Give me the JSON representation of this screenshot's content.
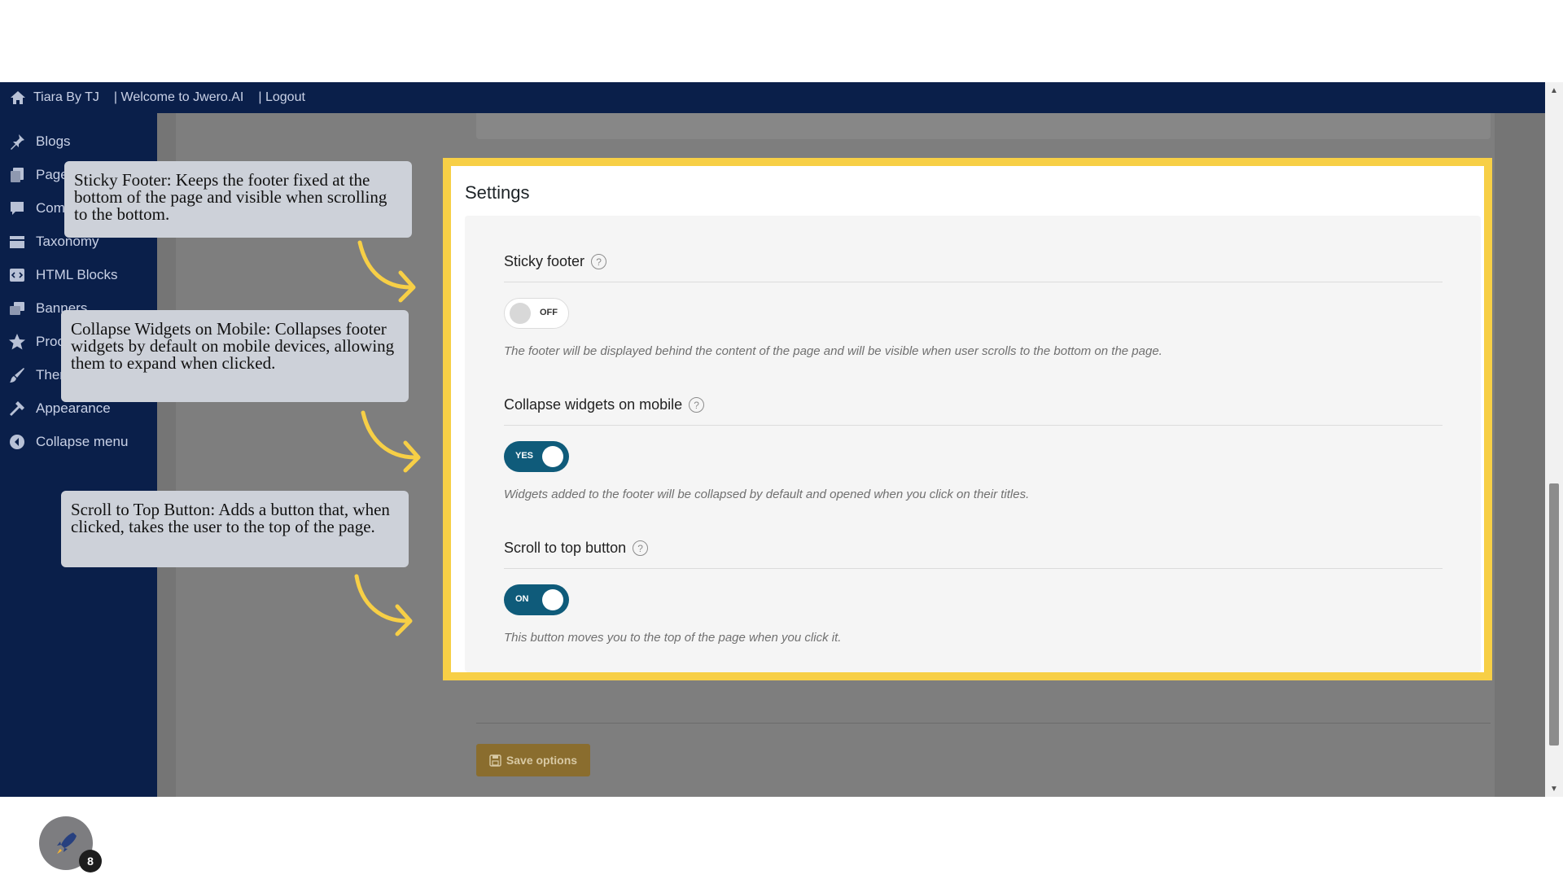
{
  "admin_bar": {
    "site_name": "Tiara By TJ",
    "welcome": "| Welcome to Jwero.AI",
    "logout": "| Logout"
  },
  "sidebar": {
    "items": [
      {
        "label": "Blogs",
        "icon": "pin-icon"
      },
      {
        "label": "Page",
        "icon": "pages-icon"
      },
      {
        "label": "Com",
        "icon": "comment-icon"
      },
      {
        "label": "Taxonomy",
        "icon": "taxonomy-icon"
      },
      {
        "label": "HTML Blocks",
        "icon": "code-block-icon"
      },
      {
        "label": "Banners",
        "icon": "banner-icon"
      },
      {
        "label": "Proc",
        "icon": "star-icon"
      },
      {
        "label": "Ther",
        "icon": "brush-icon"
      },
      {
        "label": "Appearance",
        "icon": "hammer-icon"
      },
      {
        "label": "Collapse menu",
        "icon": "collapse-icon"
      }
    ],
    "avatar_icon": "rocket-icon",
    "notification_count": "8"
  },
  "settings": {
    "title": "Settings",
    "sticky_footer": {
      "label": "Sticky footer",
      "toggle_state": "OFF",
      "description": "The footer will be displayed behind the content of the page and will be visible when user scrolls to the bottom on the page."
    },
    "collapse_widgets": {
      "label": "Collapse widgets on mobile",
      "toggle_state": "YES",
      "description": "Widgets added to the footer will be collapsed by default and opened when you click on their titles."
    },
    "scroll_top": {
      "label": "Scroll to top button",
      "toggle_state": "ON",
      "description": "This button moves you to the top of the page when you click it."
    },
    "help_glyph": "?"
  },
  "save_button": {
    "label": "Save options",
    "icon": "save-icon"
  },
  "callouts": {
    "sticky_footer": "Sticky Footer: Keeps the footer fixed at the bottom of the page and visible when scrolling to the bottom.",
    "collapse_widgets": "Collapse Widgets on Mobile: Collapses footer widgets by default on mobile devices, allowing them to expand when clicked.",
    "scroll_top": "Scroll to Top Button: Adds a button that, when clicked, takes the user to the top of the page."
  },
  "colors": {
    "admin_bg": "#0a1f4a",
    "highlight": "#f7cf46",
    "toggle_on": "#0f5b7a",
    "callout_bg": "#cdd1d9",
    "arrow": "#f7cf46"
  }
}
